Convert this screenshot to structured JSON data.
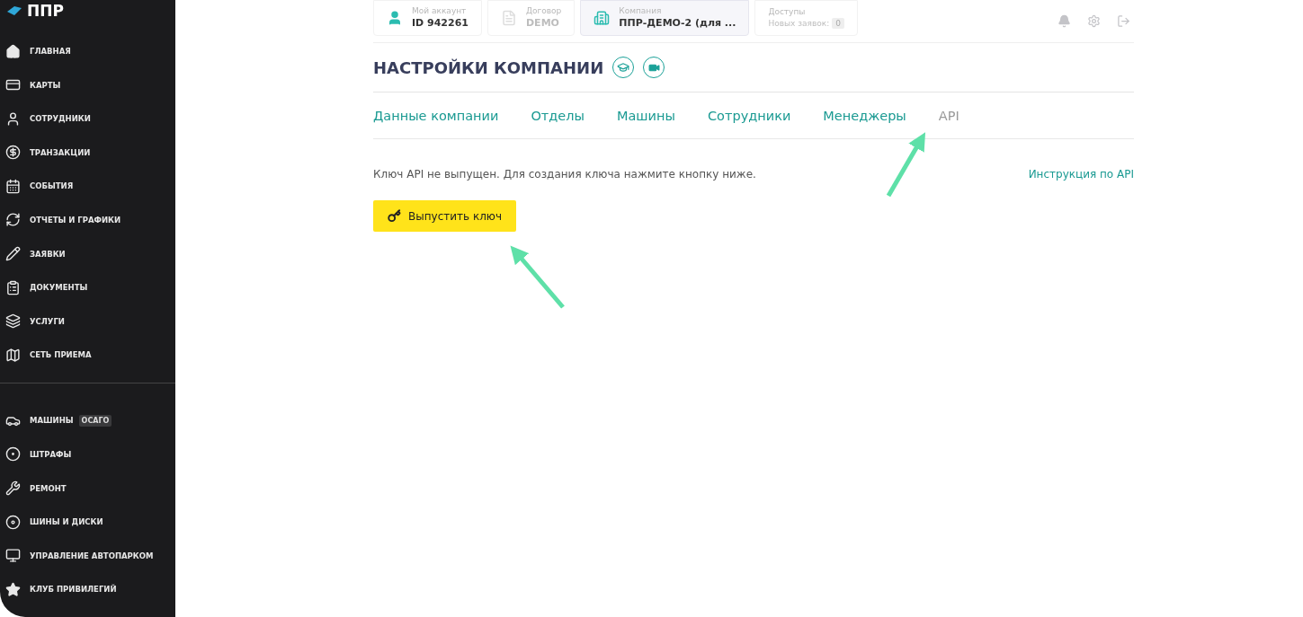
{
  "sidebar": {
    "logo": "ППР",
    "groups": [
      [
        {
          "label": "ГЛАВНАЯ"
        },
        {
          "label": "КАРТЫ"
        },
        {
          "label": "СОТРУДНИКИ"
        },
        {
          "label": "ТРАНЗАКЦИИ"
        },
        {
          "label": "СОБЫТИЯ"
        },
        {
          "label": "ОТЧЕТЫ И ГРАФИКИ"
        },
        {
          "label": "ЗАЯВКИ"
        },
        {
          "label": "ДОКУМЕНТЫ"
        },
        {
          "label": "УСЛУГИ"
        },
        {
          "label": "СЕТЬ ПРИЕМА"
        }
      ],
      [
        {
          "label": "МАШИНЫ",
          "badge": "ОСАГО"
        },
        {
          "label": "ШТРАФЫ"
        },
        {
          "label": "РЕМОНТ"
        },
        {
          "label": "ШИНЫ И ДИСКИ"
        },
        {
          "label": "УПРАВЛЕНИЕ АВТОПАРКОМ"
        },
        {
          "label": "КЛУБ ПРИВИЛЕГИЙ"
        }
      ]
    ]
  },
  "header": {
    "cards": [
      {
        "caption": "Мой аккаунт",
        "value": "ID 942261",
        "selected": false,
        "disabled": false
      },
      {
        "caption": "Договор",
        "value": "DEMO",
        "selected": false,
        "disabled": true
      },
      {
        "caption": "Компания",
        "value": "ППР-ДЕМО-2 (для ...",
        "selected": true,
        "disabled": false
      },
      {
        "caption": "Доступы",
        "value": "Новых заявок:",
        "count": "0",
        "selected": false,
        "disabled": true
      }
    ]
  },
  "page": {
    "title": "НАСТРОЙКИ КОМПАНИИ",
    "tabs": [
      {
        "label": "Данные компании",
        "selected": false
      },
      {
        "label": "Отделы",
        "selected": false
      },
      {
        "label": "Машины",
        "selected": false
      },
      {
        "label": "Сотрудники",
        "selected": false
      },
      {
        "label": "Менеджеры",
        "selected": false
      },
      {
        "label": "API",
        "selected": true
      }
    ],
    "message": "Ключ API не выпущен. Для создания ключа нажмите кнопку ниже.",
    "help_link": "Инструкция по API",
    "button": "Выпустить ключ"
  }
}
